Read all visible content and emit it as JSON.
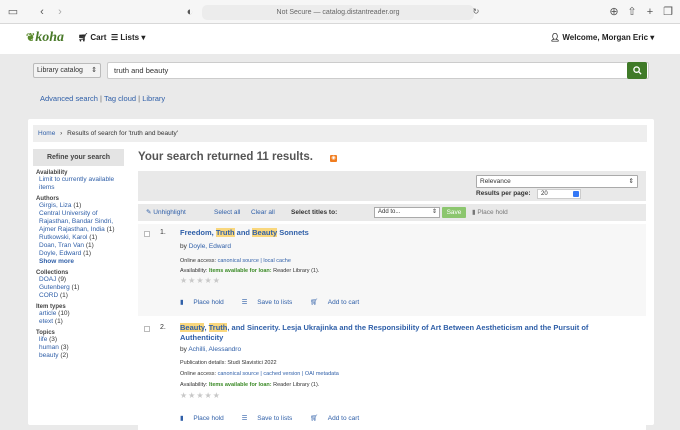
{
  "browser": {
    "url": "Not Secure — catalog.distantreader.org"
  },
  "header": {
    "logo": "koha",
    "cart": "Cart",
    "lists": "Lists",
    "welcome": "Welcome, Morgan Eric"
  },
  "search": {
    "catalog": "Library catalog",
    "query": "truth and beauty"
  },
  "subnav": {
    "advanced": "Advanced search",
    "tagcloud": "Tag cloud",
    "library": "Library"
  },
  "breadcrumb": {
    "home": "Home",
    "current": "Results of search for 'truth and beauty'"
  },
  "refine": {
    "title": "Refine your search",
    "groups": [
      {
        "name": "Availability",
        "items": [
          {
            "label": "Limit to currently available items",
            "count": ""
          }
        ]
      },
      {
        "name": "Authors",
        "items": [
          {
            "label": "Girgis, Liza",
            "count": "(1)"
          },
          {
            "label": "Central University of Rajasthan, Bandar Sindri, Ajmer Rajasthan, India",
            "count": "(1)"
          },
          {
            "label": "Rutkowski, Karol",
            "count": "(1)"
          },
          {
            "label": "Doan, Tran Van",
            "count": "(1)"
          },
          {
            "label": "Doyle, Edward",
            "count": "(1)"
          }
        ],
        "more": "Show more"
      },
      {
        "name": "Collections",
        "items": [
          {
            "label": "DOAJ",
            "count": "(9)"
          },
          {
            "label": "Gutenberg",
            "count": "(1)"
          },
          {
            "label": "CORD",
            "count": "(1)"
          }
        ]
      },
      {
        "name": "Item types",
        "items": [
          {
            "label": "article",
            "count": "(10)"
          },
          {
            "label": "etext",
            "count": "(1)"
          }
        ]
      },
      {
        "name": "Topics",
        "items": [
          {
            "label": "life",
            "count": "(3)"
          },
          {
            "label": "human",
            "count": "(3)"
          },
          {
            "label": "beauty",
            "count": "(2)"
          }
        ]
      }
    ]
  },
  "results": {
    "heading": "Your search returned 11 results.",
    "sort": "Relevance",
    "rpp_label": "Results per page:",
    "rpp": "20",
    "toolbar": {
      "unhighlight": "Unhighlight",
      "select_all": "Select all",
      "clear_all": "Clear all",
      "select_titles": "Select titles to:",
      "add_to": "Add to...",
      "save": "Save",
      "place_hold": "Place hold"
    },
    "records": [
      {
        "num": "1.",
        "title_parts": [
          "Freedom, ",
          "Truth",
          " and ",
          "Beauty",
          " Sonnets"
        ],
        "by": "by",
        "author": "Doyle, Edward",
        "online_label": "Online access:",
        "online_links": "canonical source  |  local cache",
        "availability_label": "Availability:",
        "availability": "Items available for loan:",
        "availability_rest": "Reader Library (1).",
        "actions": [
          "Place hold",
          "Save to lists",
          "Add to cart"
        ]
      },
      {
        "num": "2.",
        "title_parts": [
          "Beauty",
          ", ",
          "Truth",
          ", and Sincerity. Lesja Ukrajinka and the Responsibility of Art Between Aestheticism and the Pursuit of Authenticity"
        ],
        "by": "by",
        "author": "Achilli, Alessandro",
        "pub": "Publication details: Studi Slavistici 2022",
        "online_label": "Online access:",
        "online_links": "canonical source  |  cached version  |  OAI metadata",
        "availability_label": "Availability:",
        "availability": "Items available for loan:",
        "availability_rest": "Reader Library (1).",
        "actions": [
          "Place hold",
          "Save to lists",
          "Add to cart"
        ]
      }
    ]
  },
  "colors": {
    "link": "#2f5fa8",
    "brand": "#4a7a2a",
    "go_button": "#3f7a28",
    "highlight": "#f9d77d"
  }
}
